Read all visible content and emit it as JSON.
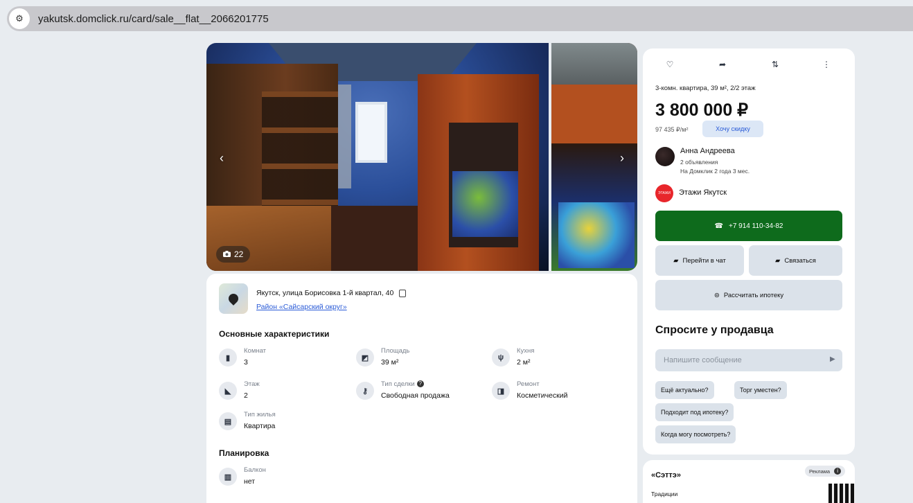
{
  "browser": {
    "url": "yakutsk.domclick.ru/card/sale__flat__2066201775",
    "site_info_icon": "tune-icon"
  },
  "gallery": {
    "photo_count": "22",
    "prev_arrow": "‹",
    "next_arrow": "›"
  },
  "location": {
    "address": "Якутск, улица Борисовка 1-й квартал, 40",
    "district": "Район «Сайсарский округ»"
  },
  "characteristics": {
    "title": "Основные характеристики",
    "items": [
      {
        "label": "Комнат",
        "value": "3",
        "icon": "door-icon"
      },
      {
        "label": "Площадь",
        "value": "39 м²",
        "icon": "area-icon"
      },
      {
        "label": "Кухня",
        "value": "2 м²",
        "icon": "kitchen-icon"
      },
      {
        "label": "Этаж",
        "value": "2",
        "icon": "stairs-icon"
      },
      {
        "label": "Тип сделки",
        "value": "Свободная продажа",
        "icon": "key-icon"
      },
      {
        "label": "Ремонт",
        "value": "Косметический",
        "icon": "paint-roller-icon"
      },
      {
        "label": "Тип жилья",
        "value": "Квартира",
        "icon": "building-icon"
      }
    ]
  },
  "layout": {
    "title": "Планировка",
    "items": [
      {
        "label": "Балкон",
        "value": "нет",
        "icon": "balcony-icon"
      }
    ]
  },
  "sidebar": {
    "flat_summary": "3-комн. квартира, 39 м², 2/2 этаж",
    "price": "3 800 000 ₽",
    "price_per_m2": "97 435 ₽/м²",
    "discount_label": "Хочу скидку",
    "agent": {
      "name": "Анна Андреева",
      "ads_count": "2 объявления",
      "since": "На Домклик 2 года 3 мес."
    },
    "agency": {
      "name": "Этажи Якутск",
      "logo_text": "ЭТАЖИ"
    },
    "phone": "+7 914 110-34-82",
    "chat_label": "Перейти в чат",
    "contact_label": "Связаться",
    "mortgage_label": "Рассчитать ипотеку",
    "ask_title": "Спросите у продавца",
    "message_placeholder": "Напишите сообщение",
    "chips": [
      "Ещё актуально?",
      "Торг уместен?",
      "Подходит под ипотеку?",
      "Когда могу посмотреть?"
    ]
  },
  "ad": {
    "title": "«Сэттэ»",
    "badge": "Реклама",
    "subtitle": "Традиции"
  },
  "colors": {
    "accent_green": "#0e6b1c",
    "link_blue": "#2a5bd7",
    "button_gray": "#dbe2ea"
  }
}
